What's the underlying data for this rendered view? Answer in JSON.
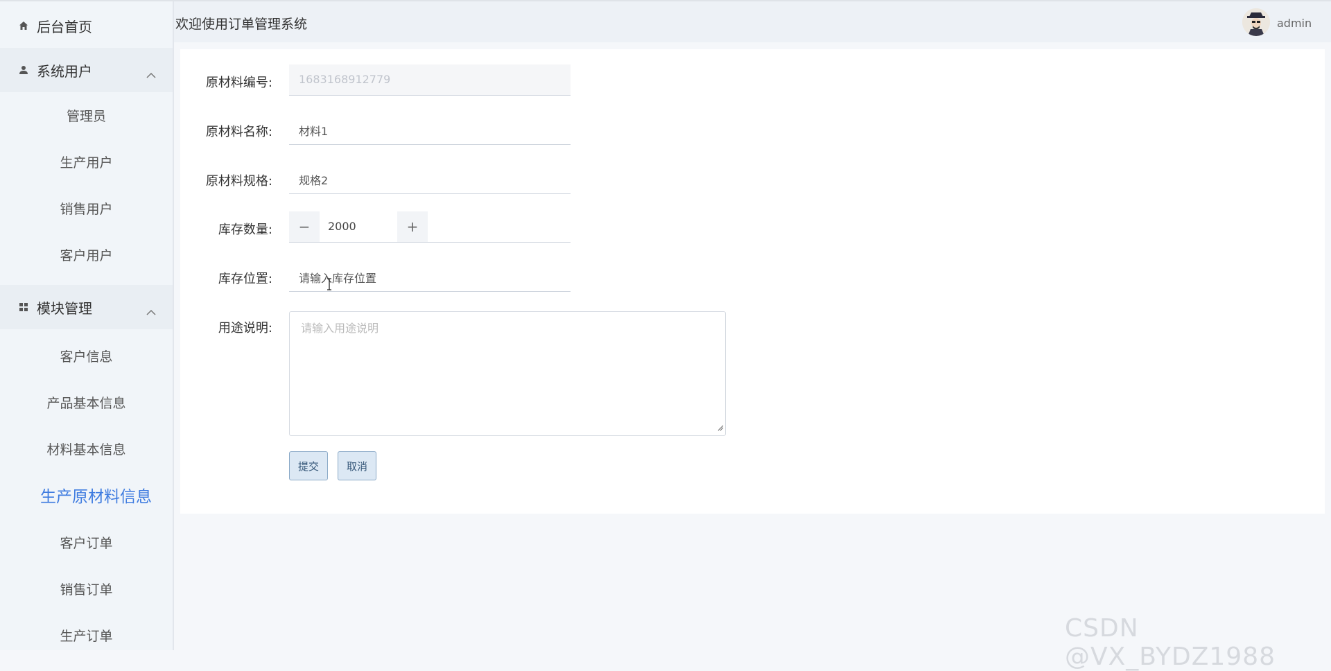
{
  "header": {
    "title": "欢迎使用订单管理系统",
    "username": "admin"
  },
  "sidebar": {
    "home": "后台首页",
    "groups": [
      {
        "label": "系统用户",
        "icon": "user-icon",
        "items": [
          "管理员",
          "生产用户",
          "销售用户",
          "客户用户"
        ]
      },
      {
        "label": "模块管理",
        "icon": "grid-icon",
        "items": [
          "客户信息",
          "产品基本信息",
          "材料基本信息",
          "生产原材料信息",
          "客户订单",
          "销售订单",
          "生产订单"
        ]
      }
    ],
    "active_item": "生产原材料信息"
  },
  "form": {
    "fields": [
      {
        "label": "原材料编号:",
        "value": "1683168912779",
        "placeholder": "",
        "disabled": true
      },
      {
        "label": "原材料名称:",
        "value": "材料1",
        "placeholder": ""
      },
      {
        "label": "原材料规格:",
        "value": "规格2",
        "placeholder": ""
      },
      {
        "label": "库存数量:",
        "value": "2000",
        "type": "stepper"
      },
      {
        "label": "库存位置:",
        "value": "",
        "placeholder": "请输入库存位置"
      },
      {
        "label": "用途说明:",
        "value": "",
        "placeholder": "请输入用途说明",
        "type": "textarea"
      }
    ],
    "stepper_minus": "−",
    "stepper_plus": "+",
    "submit_label": "提交",
    "cancel_label": "取消"
  },
  "watermark": "CSDN @VX_BYDZ1988",
  "colors": {
    "accent": "#3f7ce0",
    "sidebar_bg": "#f1f5f9",
    "header_bg": "#edf1f6",
    "button_bg": "#dce8f4"
  }
}
